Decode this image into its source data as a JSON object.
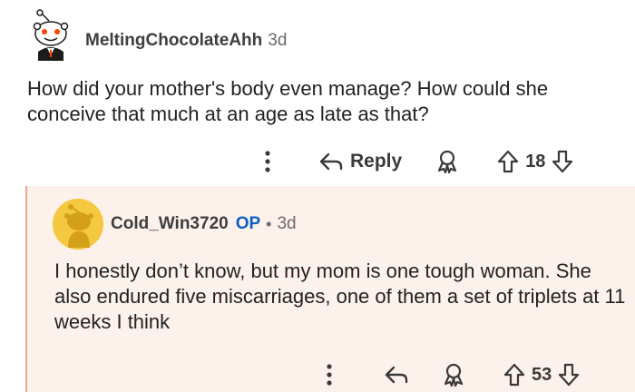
{
  "comments": [
    {
      "author": "MeltingChocolateAhh",
      "age": "3d",
      "body": "How did your mother's body even manage? How could she conceive that much at an age as late as that?",
      "reply_label": "Reply",
      "score": "18",
      "icons": [
        "more-vertical-icon",
        "reply-icon",
        "award-icon",
        "upvote-icon",
        "downvote-icon"
      ]
    },
    {
      "author": "Cold_Win3720",
      "op_badge": "OP",
      "separator": "•",
      "age": "3d",
      "body": "I honestly don’t know, but my mom is one tough woman. She also endured five miscarriages, one of them a set of triplets at 11 weeks I think",
      "score": "53",
      "icons": [
        "more-vertical-icon",
        "reply-icon",
        "award-icon",
        "upvote-icon",
        "downvote-icon"
      ]
    }
  ],
  "colors": {
    "reply_background": "#fdf1ec",
    "thread_line": "#e9a792",
    "op_badge": "#0c5ec7",
    "avatar_yellow": "#f5c842",
    "snoo_orange": "#ff4500"
  }
}
